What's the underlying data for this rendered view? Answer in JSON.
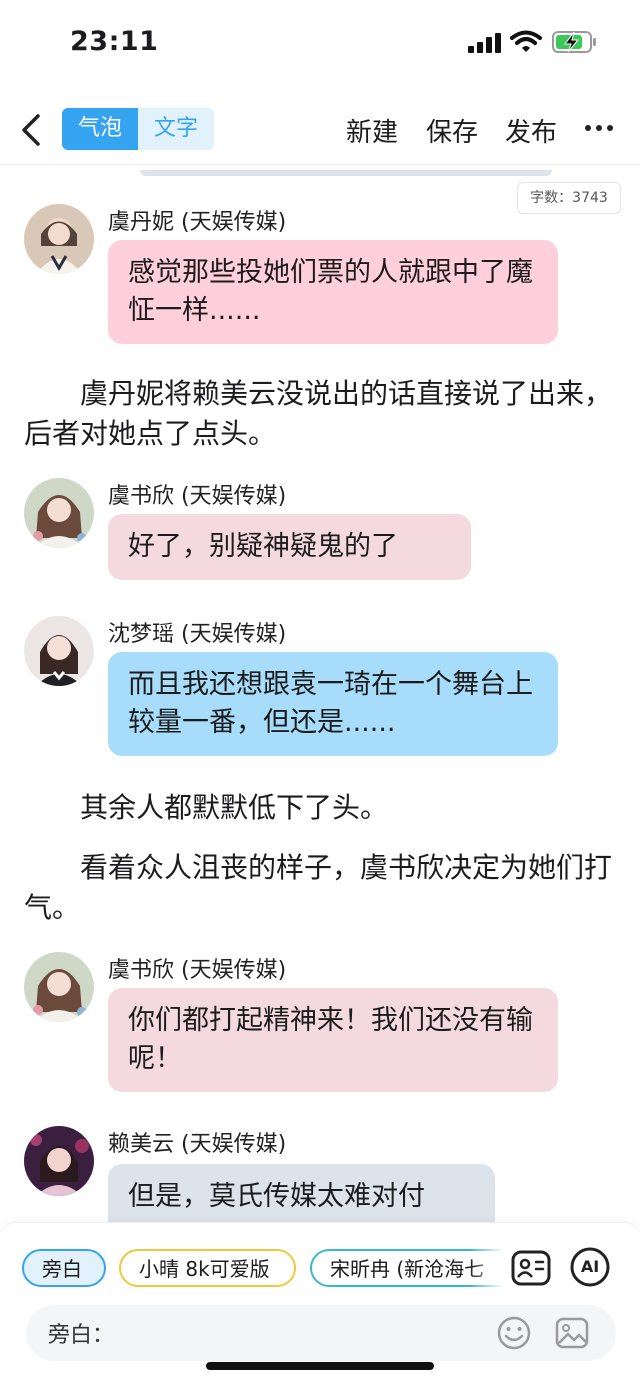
{
  "status_bar": {
    "time": "23:11"
  },
  "toolbar": {
    "tab_bubble": "气泡",
    "tab_text": "文字",
    "new_label": "新建",
    "save_label": "保存",
    "publish_label": "发布"
  },
  "word_count": "字数：3743",
  "messages": [
    {
      "speaker": "虞丹妮 (天娱传媒)",
      "text": "感觉那些投她们票的人就跟中了魔怔一样......"
    },
    {
      "speaker": "虞书欣 (天娱传媒)",
      "text": "好了，别疑神疑鬼的了"
    },
    {
      "speaker": "沈梦瑶 (天娱传媒)",
      "text": "而且我还想跟袁一琦在一个舞台上较量一番，但还是......"
    },
    {
      "speaker": "虞书欣 (天娱传媒)",
      "text": "你们都打起精神来！我们还没有输呢！"
    },
    {
      "speaker": "赖美云 (天娱传媒)",
      "text": "但是，莫氏传媒太难对付"
    }
  ],
  "narrations": [
    "虞丹妮将赖美云没说出的话直接说了出来，后者对她点了点头。",
    "其余人都默默低下了头。",
    "看着众人沮丧的样子，虞书欣决定为她们打气。"
  ],
  "bottom": {
    "chips": [
      "旁白",
      "小晴 8k可爱版",
      "宋昕冉 (新沧海七"
    ],
    "input_label": "旁白：",
    "ai_label": "AI"
  },
  "colors": {
    "accent": "#35a4f0",
    "bubble_pink": "#ffcfdc",
    "bubble_rose": "#f4dadf",
    "bubble_blue": "#a7dcfa",
    "bubble_gray": "#dde3ea"
  },
  "icons": [
    "back-icon",
    "more-icon",
    "signal-icon",
    "wifi-icon",
    "battery-charging-icon",
    "role-card-icon",
    "ai-icon",
    "emoji-icon",
    "image-icon"
  ]
}
